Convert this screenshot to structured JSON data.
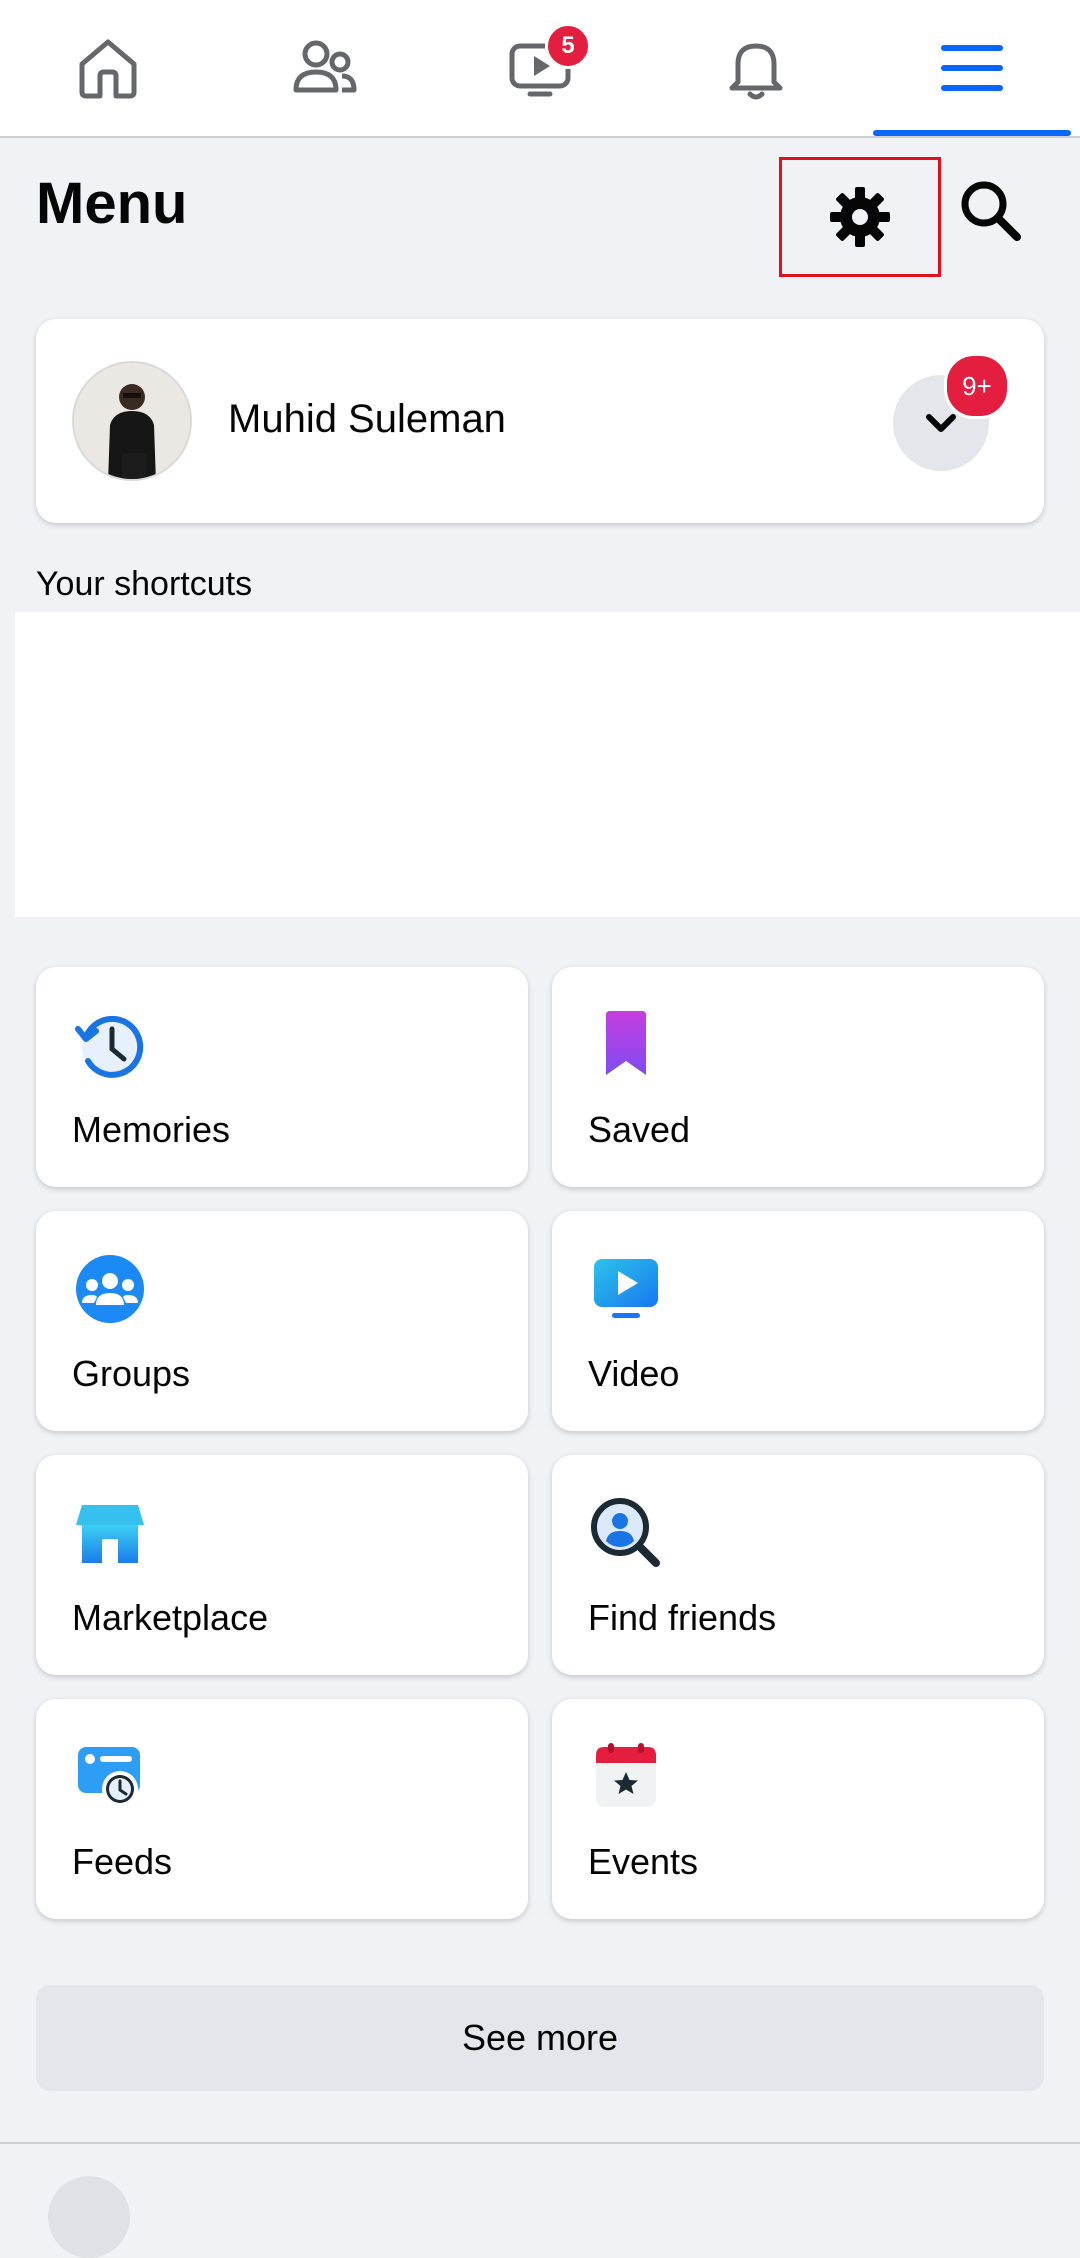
{
  "nav": {
    "tabs": [
      {
        "name": "home",
        "icon": "home-icon"
      },
      {
        "name": "friends",
        "icon": "friends-icon"
      },
      {
        "name": "video",
        "icon": "video-icon",
        "badge": "5"
      },
      {
        "name": "notifications",
        "icon": "bell-icon"
      },
      {
        "name": "menu",
        "icon": "hamburger-menu-icon",
        "active": true
      }
    ],
    "video_badge": "5"
  },
  "header": {
    "title": "Menu",
    "settings_icon": "gear-icon",
    "search_icon": "search-icon"
  },
  "profile": {
    "name": "Muhid Suleman",
    "badge": "9+",
    "switch_icon": "chevron-down-icon"
  },
  "shortcuts": {
    "label": "Your shortcuts"
  },
  "tiles": [
    {
      "label": "Memories",
      "icon": "memories-clock-icon"
    },
    {
      "label": "Saved",
      "icon": "bookmark-icon"
    },
    {
      "label": "Groups",
      "icon": "groups-icon"
    },
    {
      "label": "Video",
      "icon": "video-screen-icon"
    },
    {
      "label": "Marketplace",
      "icon": "marketplace-shop-icon"
    },
    {
      "label": "Find friends",
      "icon": "find-friends-icon"
    },
    {
      "label": "Feeds",
      "icon": "feeds-icon"
    },
    {
      "label": "Events",
      "icon": "events-calendar-icon"
    }
  ],
  "see_more": "See more",
  "colors": {
    "accent": "#0866ff",
    "badge": "#e41e3f",
    "background": "#f0f2f5",
    "highlight_box": "#e0111f"
  }
}
